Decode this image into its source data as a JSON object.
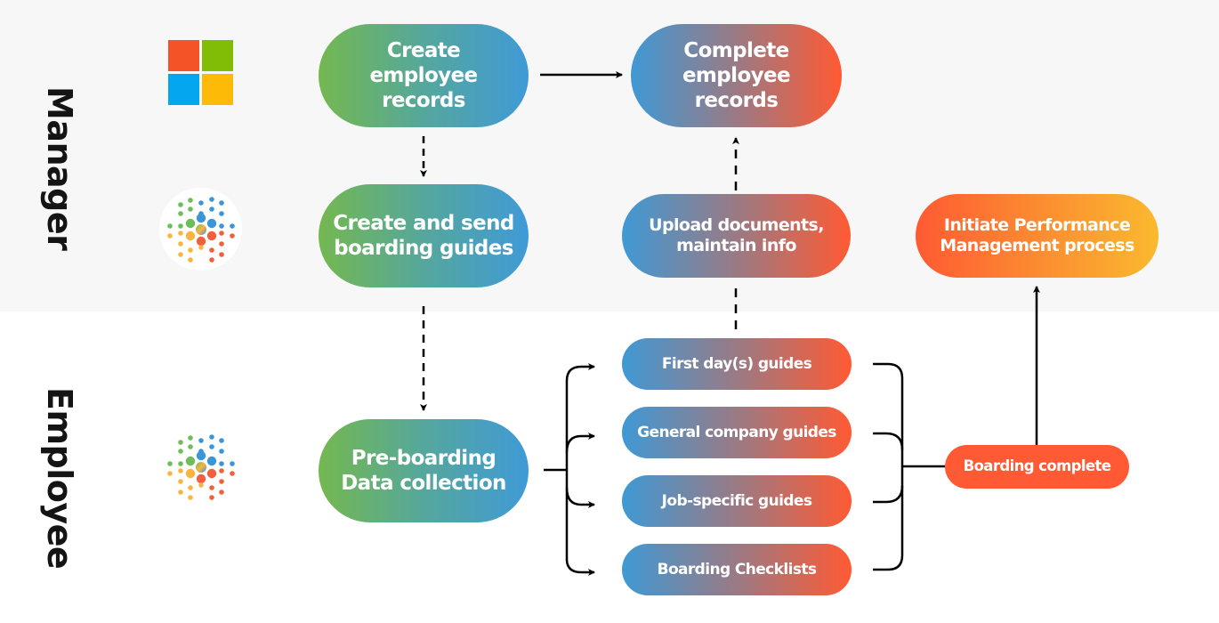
{
  "lanes": {
    "manager": {
      "label": "Manager"
    },
    "employee": {
      "label": "Employee"
    }
  },
  "icons": {
    "manager_top": "microsoft-logo",
    "manager_bottom": "dot-burst-logo",
    "employee": "dot-burst-logo"
  },
  "colors": {
    "green": "#74b84f",
    "blue": "#3f99d5",
    "red": "#ff5a33",
    "yellow": "#fbb92f",
    "manager_lane_bg": "#f7f7f7",
    "employee_lane_bg": "#ffffff"
  },
  "nodes": {
    "create_records": {
      "line1": "Create employee",
      "line2": "records"
    },
    "create_guides": {
      "line1": "Create and send",
      "line2": "boarding guides"
    },
    "complete_records": {
      "line1": "Complete",
      "line2": "employee records"
    },
    "upload_docs": {
      "line1": "Upload documents,",
      "line2": "maintain info"
    },
    "initiate_pm": {
      "line1": "Initiate Performance",
      "line2": "Management process"
    },
    "preboarding": {
      "line1": "Pre-boarding",
      "line2": "Data collection"
    },
    "guides": [
      {
        "label": "First day(s) guides"
      },
      {
        "label": "General company guides"
      },
      {
        "label": "Job-specific guides"
      },
      {
        "label": "Boarding Checklists"
      }
    ],
    "boarding_complete": {
      "label": "Boarding complete"
    }
  },
  "edges": [
    {
      "from": "create_records",
      "to": "complete_records",
      "style": "solid"
    },
    {
      "from": "create_records",
      "to": "create_guides",
      "style": "dashed"
    },
    {
      "from": "create_guides",
      "to": "preboarding",
      "style": "dashed"
    },
    {
      "from": "upload_docs",
      "to": "complete_records",
      "style": "dashed"
    },
    {
      "from": "guides",
      "to": "upload_docs",
      "style": "dashed"
    },
    {
      "from": "preboarding",
      "to": "guides",
      "style": "solid-bracket"
    },
    {
      "from": "guides",
      "to": "boarding_complete",
      "style": "solid-bracket"
    },
    {
      "from": "boarding_complete",
      "to": "initiate_pm",
      "style": "solid"
    }
  ]
}
